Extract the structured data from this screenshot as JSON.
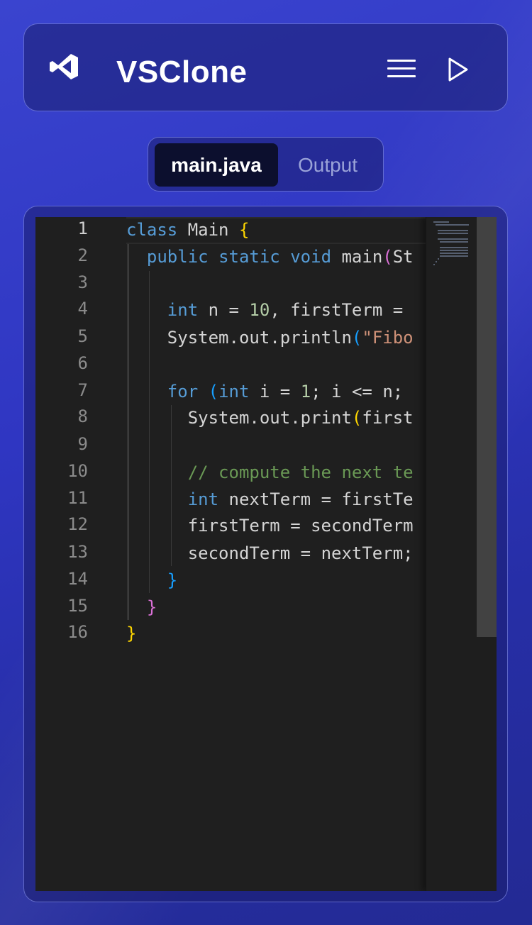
{
  "header": {
    "app_title": "VSClone",
    "menu_icon": "hamburger-menu-icon",
    "run_icon": "play-icon"
  },
  "tabs": [
    {
      "label": "main.java",
      "active": true
    },
    {
      "label": "Output",
      "active": false
    }
  ],
  "editor": {
    "language": "java",
    "line_numbers": [
      "1",
      "2",
      "3",
      "4",
      "5",
      "6",
      "7",
      "8",
      "9",
      "10",
      "11",
      "12",
      "13",
      "14",
      "15",
      "16"
    ],
    "current_line": 1,
    "lines": [
      "class Main {",
      "  public static void main(St",
      "",
      "    int n = 10, firstTerm = ",
      "    System.out.println(\"Fibo",
      "",
      "    for (int i = 1; i <= n; ",
      "      System.out.print(first",
      "",
      "      // compute the next te",
      "      int nextTerm = firstTe",
      "      firstTerm = secondTerm",
      "      secondTerm = nextTerm;",
      "    }",
      "  }",
      "}"
    ]
  },
  "colors": {
    "background_start": "#3a44cf",
    "panel_border": "#969fff",
    "editor_bg": "#1f1f1f",
    "keyword": "#569cd6",
    "number": "#b5cea8",
    "string": "#ce9178",
    "comment": "#6a9955",
    "bracket_level1": "#ffd700",
    "bracket_level2": "#da70d6",
    "bracket_level3": "#179fff"
  }
}
